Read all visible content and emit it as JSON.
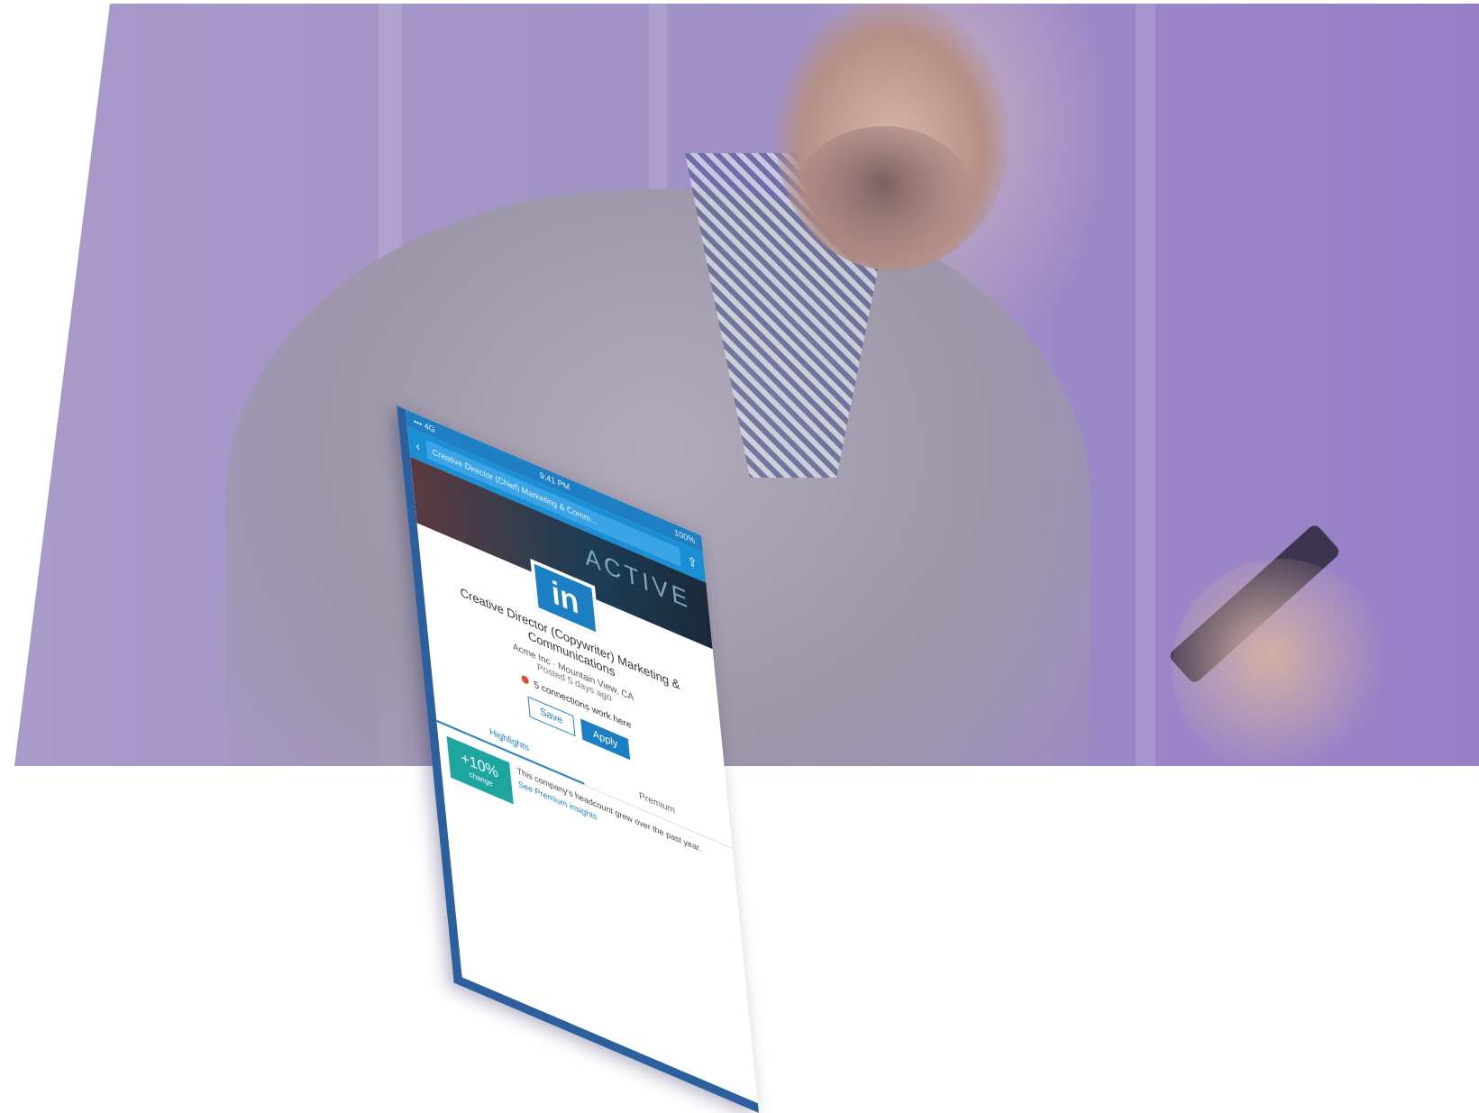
{
  "colors": {
    "overlay": "#9e8fc6",
    "phone_frame": "#2b5f9d",
    "accent": "#1b7fc4",
    "insight_badge": "#1fa5a0",
    "dot": "#e64b2c"
  },
  "phone": {
    "status": {
      "left": "••• 4G",
      "time": "9:41 PM",
      "right": "100%"
    },
    "url": "Creative Director (Chief) Marketing & Comm...",
    "cover_word": "ACTIVE",
    "logo": "in",
    "job_title": "Creative Director (Copywriter) Marketing & Communications",
    "company": "Acme Inc · Mountain View, CA",
    "location": "Posted 5 days ago",
    "connections": "5 connections work here",
    "save_label": "Save",
    "apply_label": "Apply",
    "tabs": [
      "Highlights",
      "Premium"
    ],
    "insight_value": "+10%",
    "insight_caption": "change",
    "insight_text": "This company's headcount grew over the past year.",
    "insight_link": "See Premium insights"
  },
  "icons": [
    "back-arrow-icon",
    "share-icon"
  ]
}
